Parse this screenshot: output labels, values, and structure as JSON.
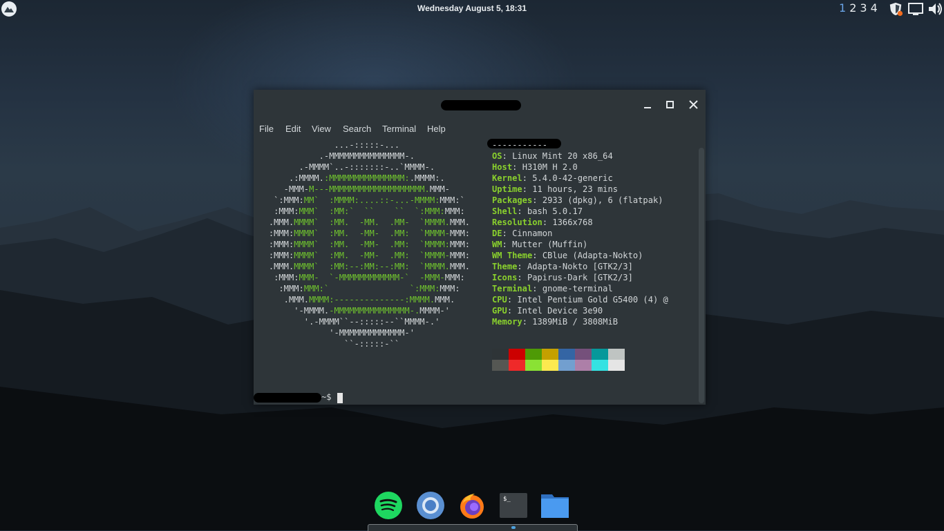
{
  "panel": {
    "clock": "Wednesday August  5, 18:31",
    "workspaces": [
      "1",
      "2",
      "3",
      "4"
    ],
    "active_workspace": "1",
    "tray_icons": [
      "shield-update-icon",
      "display-icon",
      "volume-icon"
    ]
  },
  "terminal": {
    "menu": [
      "File",
      "Edit",
      "Search",
      "Terminal",
      "Help"
    ],
    "menu_view": "View",
    "separator": "-----------",
    "info": [
      {
        "key": "OS",
        "value": "Linux Mint 20 x86_64"
      },
      {
        "key": "Host",
        "value": "H310M H 2.0"
      },
      {
        "key": "Kernel",
        "value": "5.4.0-42-generic"
      },
      {
        "key": "Uptime",
        "value": "11 hours, 23 mins"
      },
      {
        "key": "Packages",
        "value": "2933 (dpkg), 6 (flatpak)"
      },
      {
        "key": "Shell",
        "value": "bash 5.0.17"
      },
      {
        "key": "Resolution",
        "value": "1366x768"
      },
      {
        "key": "DE",
        "value": "Cinnamon"
      },
      {
        "key": "WM",
        "value": "Mutter (Muffin)"
      },
      {
        "key": "WM Theme",
        "value": "CBlue (Adapta-Nokto)"
      },
      {
        "key": "Theme",
        "value": "Adapta-Nokto [GTK2/3]"
      },
      {
        "key": "Icons",
        "value": "Papirus-Dark [GTK2/3]"
      },
      {
        "key": "Terminal",
        "value": "gnome-terminal"
      },
      {
        "key": "CPU",
        "value": "Intel Pentium Gold G5400 (4) @"
      },
      {
        "key": "GPU",
        "value": "Intel Device 3e90"
      },
      {
        "key": "Memory",
        "value": "1389MiB / 3808MiB"
      }
    ],
    "palette_top": [
      "#2e3437",
      "#cc0000",
      "#4e9a06",
      "#c4a000",
      "#3465a4",
      "#75507b",
      "#06989a",
      "#bfc4c2"
    ],
    "palette_bottom": [
      "#555753",
      "#ef2929",
      "#8ae234",
      "#fce94f",
      "#729fcf",
      "#ad7fa8",
      "#34e2e2",
      "#e5e5e5"
    ],
    "prompt": "~$"
  },
  "dock": {
    "apps": [
      "spotify-icon",
      "chromium-icon",
      "firefox-icon",
      "terminal-icon",
      "files-icon"
    ]
  }
}
